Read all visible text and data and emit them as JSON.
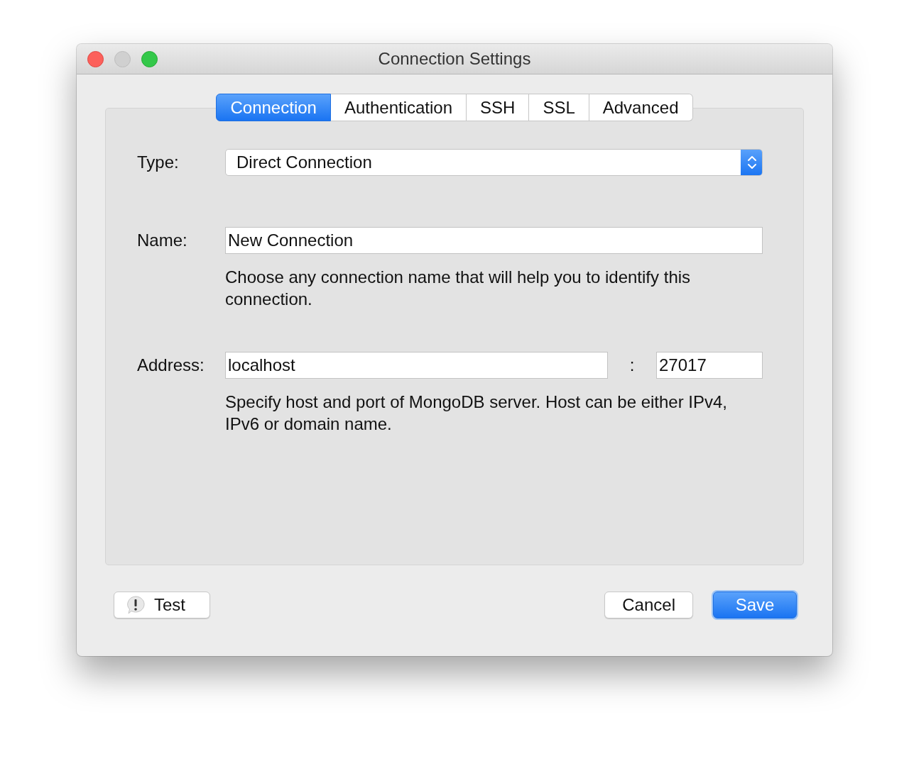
{
  "window": {
    "title": "Connection Settings",
    "controls": [
      {
        "kind": "close",
        "disabled": false
      },
      {
        "kind": "minimize",
        "disabled": true
      },
      {
        "kind": "zoom",
        "disabled": false
      }
    ]
  },
  "tabs": [
    {
      "label": "Connection",
      "selected": true
    },
    {
      "label": "Authentication",
      "selected": false
    },
    {
      "label": "SSH",
      "selected": false
    },
    {
      "label": "SSL",
      "selected": false
    },
    {
      "label": "Advanced",
      "selected": false
    }
  ],
  "form": {
    "type": {
      "label": "Type:",
      "value": "Direct Connection"
    },
    "name": {
      "label": "Name:",
      "value": "New Connection",
      "help": "Choose any connection name that will help you to identify this connection."
    },
    "address": {
      "label": "Address:",
      "host": "localhost",
      "separator": ":",
      "port": "27017",
      "help": "Specify host and port of MongoDB server. Host can be either IPv4, IPv6 or domain name."
    }
  },
  "footer": {
    "left_buttons": [
      {
        "label": "Test",
        "kind": "alert",
        "default": false
      }
    ],
    "right_buttons": [
      {
        "label": "Cancel",
        "default": false
      },
      {
        "label": "Save",
        "default": true
      }
    ]
  }
}
